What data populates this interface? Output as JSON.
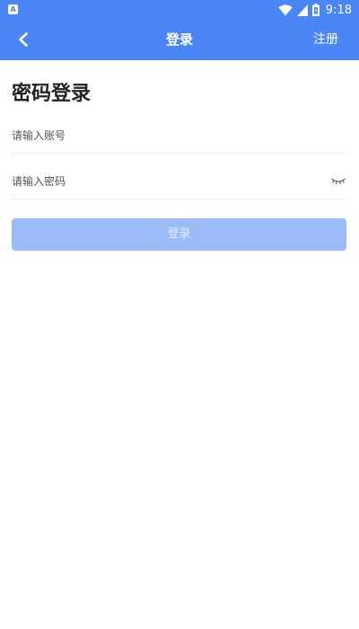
{
  "status_bar": {
    "app_badge": "A",
    "time": "9:18",
    "icons": [
      "wifi-icon",
      "cellular-signal-icon",
      "battery-icon"
    ]
  },
  "app_bar": {
    "title": "登录",
    "back_icon": "chevron-left-icon",
    "register_label": "注册"
  },
  "page": {
    "heading": "密码登录"
  },
  "form": {
    "account_placeholder": "请输入账号",
    "password_placeholder": "请输入密码",
    "password_toggle_icon": "eye-closed-icon",
    "submit_label": "登录"
  },
  "colors": {
    "primary": "#4a86f5",
    "button_disabled": "#9bbcf7",
    "heading": "#222222"
  }
}
